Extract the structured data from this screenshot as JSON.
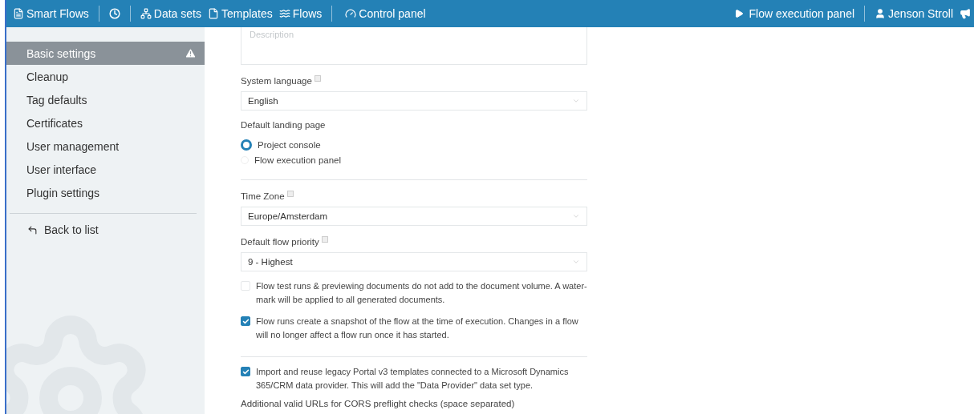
{
  "topbar": {
    "brand": "Smart Flows",
    "links": [
      "Data sets",
      "Templates",
      "Flows"
    ],
    "control_panel": "Control panel",
    "execution_panel": "Flow execution panel",
    "user": "Jenson Stroll"
  },
  "sidebar": {
    "items": [
      {
        "label": "Basic settings",
        "selected": true,
        "warning": true
      },
      {
        "label": "Cleanup",
        "selected": false,
        "warning": false
      },
      {
        "label": "Tag defaults",
        "selected": false,
        "warning": false
      },
      {
        "label": "Certificates",
        "selected": false,
        "warning": false
      },
      {
        "label": "User management",
        "selected": false,
        "warning": false
      },
      {
        "label": "User interface",
        "selected": false,
        "warning": false
      },
      {
        "label": "Plugin settings",
        "selected": false,
        "warning": false
      }
    ],
    "back": "Back to list"
  },
  "form": [
    {
      "kind": "textarea",
      "placeholder": "Description"
    },
    {
      "kind": "select",
      "label": "System language",
      "help": true,
      "value": "English"
    },
    {
      "kind": "radio_group",
      "label": "Default landing page",
      "options": [
        {
          "label": "Project console",
          "selected": true
        },
        {
          "label": "Flow execution panel",
          "selected": false
        }
      ]
    },
    {
      "kind": "divider"
    },
    {
      "kind": "select",
      "label": "Time Zone",
      "help": true,
      "value": "Europe/Amsterdam"
    },
    {
      "kind": "select",
      "label": "Default flow priority",
      "help": true,
      "value": "9 - Highest"
    },
    {
      "kind": "checkbox",
      "label": "Flow test runs & previewing documents do not add to the document volume. A water-mark will be applied to all generated documents.",
      "checked": false
    },
    {
      "kind": "checkbox",
      "label": "Flow runs create a snapshot of the flow at the time of execution. Changes in a flow will no longer affect a flow run once it has started.",
      "checked": true
    },
    {
      "kind": "divider"
    },
    {
      "kind": "checkbox",
      "label": "Import and reuse legacy Portal v3 templates connected to a Microsoft Dynamics 365/CRM data provider. This will add the \"Data Provider\" data set type.",
      "checked": true
    },
    {
      "kind": "heading",
      "label": "Additional valid URLs for CORS preflight checks (space separated)"
    }
  ]
}
